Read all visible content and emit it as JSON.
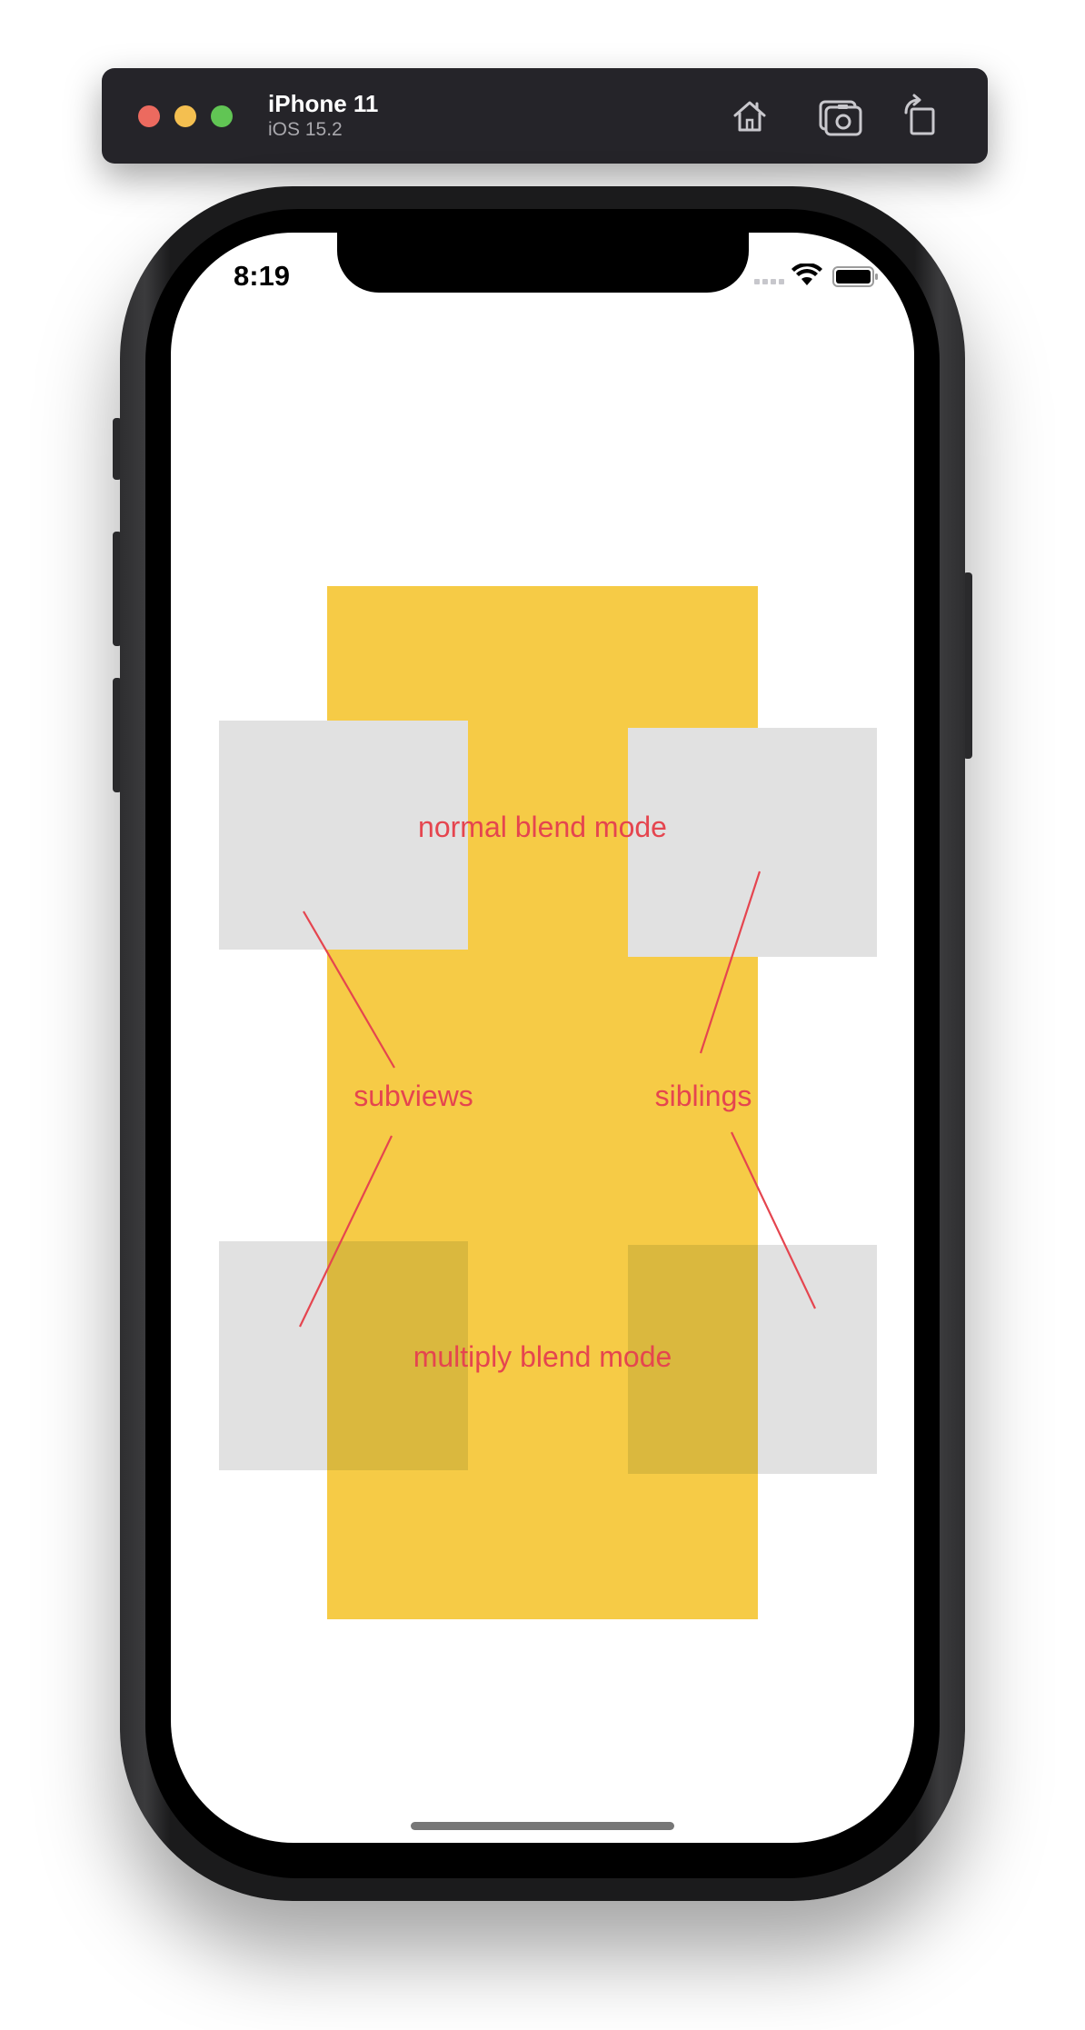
{
  "simulator": {
    "device_name": "iPhone 11",
    "os_version": "iOS 15.2",
    "buttons": {
      "home": "home-icon",
      "screenshot": "screenshot-icon",
      "rotate": "rotate-icon"
    }
  },
  "status_bar": {
    "time": "8:19",
    "icons": [
      "cellular-signal-icon",
      "wifi-icon",
      "battery-icon"
    ]
  },
  "content": {
    "labels": {
      "normal": "normal blend mode",
      "multiply": "multiply blend mode",
      "subviews": "subviews",
      "siblings": "siblings"
    },
    "colors": {
      "yellow_view": "#f6cb46",
      "gray_box": "#e1e1e1",
      "multiply_overlap": "#dab83e",
      "label_text": "#e5454f"
    }
  }
}
